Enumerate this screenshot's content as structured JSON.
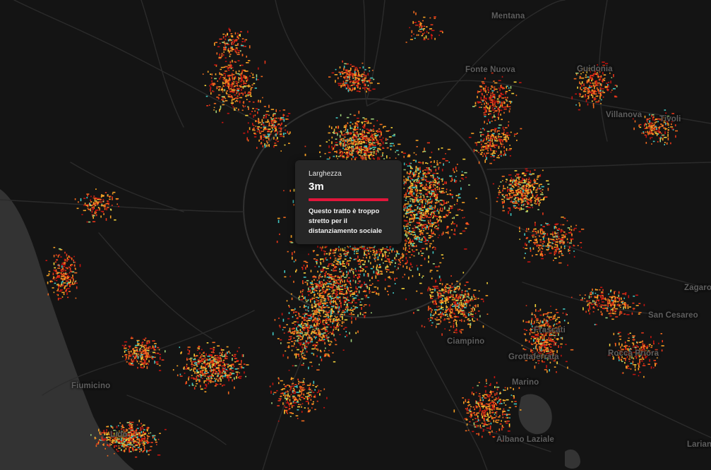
{
  "places": [
    {
      "name": "Mentana"
    },
    {
      "name": "Fonte Nuova"
    },
    {
      "name": "Guidonia"
    },
    {
      "name": "Villanova"
    },
    {
      "name": "Tivoli"
    },
    {
      "name": "Zagaro"
    },
    {
      "name": "San Cesareo"
    },
    {
      "name": "Frascati"
    },
    {
      "name": "Ciampino"
    },
    {
      "name": "Rocca Priora"
    },
    {
      "name": "Grottaferrata"
    },
    {
      "name": "Marino"
    },
    {
      "name": "Albano Laziale"
    },
    {
      "name": "Lariano"
    },
    {
      "name": "Fiumicino"
    },
    {
      "name": "Lido"
    }
  ],
  "popup": {
    "label": "Larghezza",
    "value": "3m",
    "bar_color": "#e2163b",
    "message": "Questo tratto è troppo stretto per il distanziamento sociale"
  },
  "colors": {
    "background": "#141414",
    "sea": "#343434",
    "roads": "#2a2a2a",
    "segment_scale": [
      "#c4130f",
      "#e8361a",
      "#f06a1e",
      "#f5a024",
      "#f5d33a",
      "#9fd07a",
      "#41c7c3"
    ]
  }
}
